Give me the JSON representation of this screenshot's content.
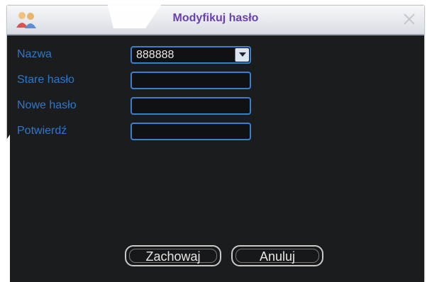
{
  "window": {
    "title": "Modyfikuj hasło"
  },
  "form": {
    "name_label": "Nazwa",
    "name_value": "888888",
    "old_password_label": "Stare hasło",
    "new_password_label": "Nowe hasło",
    "confirm_label": "Potwierdź"
  },
  "buttons": {
    "save_label": "Zachowaj",
    "cancel_label": "Anuluj"
  },
  "icons": {
    "app": "user-group-icon",
    "close": "close-icon",
    "dropdown": "chevron-down-icon"
  },
  "colors": {
    "title": "#6a3fb3",
    "label": "#2f77c8",
    "field_border": "#3b7ecf",
    "background": "#1b1c1e"
  }
}
